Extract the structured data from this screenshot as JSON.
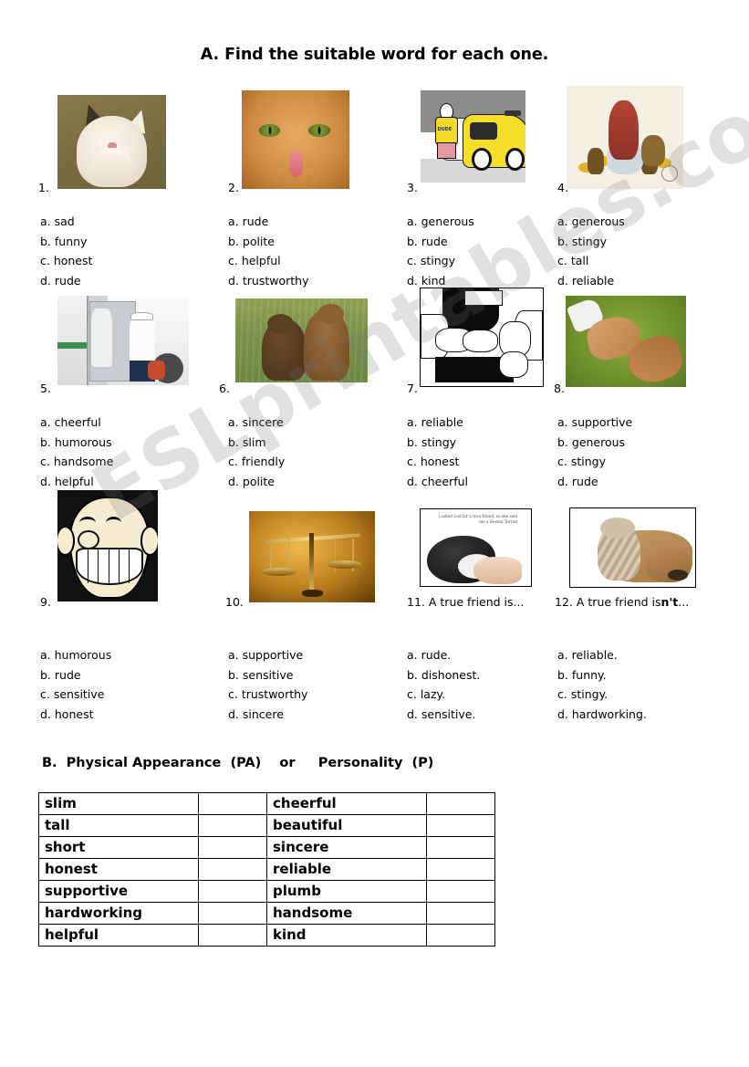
{
  "worksheet": {
    "watermark": "ESLprintables.com",
    "section_a": {
      "title": "A. Find the suitable word for each one.",
      "questions": [
        {
          "number": "1.",
          "image": "cat-laughing-photo",
          "caption": "",
          "options": [
            "a. sad",
            "b. funny",
            "c. honest",
            "d. rude"
          ]
        },
        {
          "number": "2.",
          "image": "angry-cat-tongue-photo",
          "caption": "",
          "options": [
            "a. rude",
            "b. polite",
            "c. helpful",
            "d. trustworthy"
          ]
        },
        {
          "number": "3.",
          "image": "taxi-driver-cartoon",
          "caption": "",
          "options": [
            "a. generous",
            "b. rude",
            "c. stingy",
            "d. kind"
          ]
        },
        {
          "number": "4.",
          "image": "scrooge-gold-coins-cartoon",
          "caption": "",
          "options": [
            "a. generous",
            "b. stingy",
            "c. tall",
            "d. reliable"
          ]
        },
        {
          "number": "5.",
          "image": "bus-driver-helping-photo",
          "caption": "",
          "options": [
            "a. cheerful",
            "b. humorous",
            "c. handsome",
            "d. helpful"
          ]
        },
        {
          "number": "6.",
          "image": "two-bears-hugging-photo",
          "caption": "",
          "options": [
            "a. sincere",
            "b. slim",
            "c. friendly",
            "d. polite"
          ]
        },
        {
          "number": "7.",
          "image": "handshake-pickpocket-lineart",
          "caption": "",
          "options": [
            "a. reliable",
            "b. stingy",
            "c. honest",
            "d. cheerful"
          ]
        },
        {
          "number": "8.",
          "image": "adult-child-hands-photo",
          "caption": "",
          "options": [
            "a. supportive",
            "b. generous",
            "c. stingy",
            "d. rude"
          ]
        },
        {
          "number": "9.",
          "image": "grinning-cartoon-face",
          "caption": "",
          "options": [
            "a. humorous",
            "b. rude",
            "c. sensitive",
            "d. honest"
          ]
        },
        {
          "number": "10.",
          "image": "balance-scales-photo",
          "caption": "",
          "options": [
            "a. supportive",
            "b. sensitive",
            "c. trustworthy",
            "d. sincere"
          ]
        },
        {
          "number": "11.",
          "image": "boston-terrier-true-friend-photo",
          "caption": "A true friend is...",
          "caption_bold": "",
          "image_overlay_text": "I asked God for a true friend, so she sent me a Boston Terrier",
          "options": [
            "a. rude.",
            "b. dishonest.",
            "c. lazy.",
            "d. sensitive."
          ]
        },
        {
          "number": "12.",
          "image": "dog-and-cat-cuddling-photo",
          "caption": "A true friend is",
          "caption_bold": "n't",
          "caption_tail": "...",
          "options": [
            "a. reliable.",
            "b. funny.",
            "c. stingy.",
            "d. hardworking."
          ]
        }
      ]
    },
    "section_b": {
      "title": "B.  Physical Appearance  (PA)    or     Personality  (P)",
      "rows": [
        {
          "left_word": "slim",
          "left_answer": "",
          "right_word": "cheerful",
          "right_answer": ""
        },
        {
          "left_word": "tall",
          "left_answer": "",
          "right_word": "beautiful",
          "right_answer": ""
        },
        {
          "left_word": "short",
          "left_answer": "",
          "right_word": "sincere",
          "right_answer": ""
        },
        {
          "left_word": "honest",
          "left_answer": "",
          "right_word": "reliable",
          "right_answer": ""
        },
        {
          "left_word": "supportive",
          "left_answer": "",
          "right_word": "plumb",
          "right_answer": ""
        },
        {
          "left_word": "hardworking",
          "left_answer": "",
          "right_word": "handsome",
          "right_answer": ""
        },
        {
          "left_word": "helpful",
          "left_answer": "",
          "right_word": "kind",
          "right_answer": ""
        }
      ]
    }
  }
}
